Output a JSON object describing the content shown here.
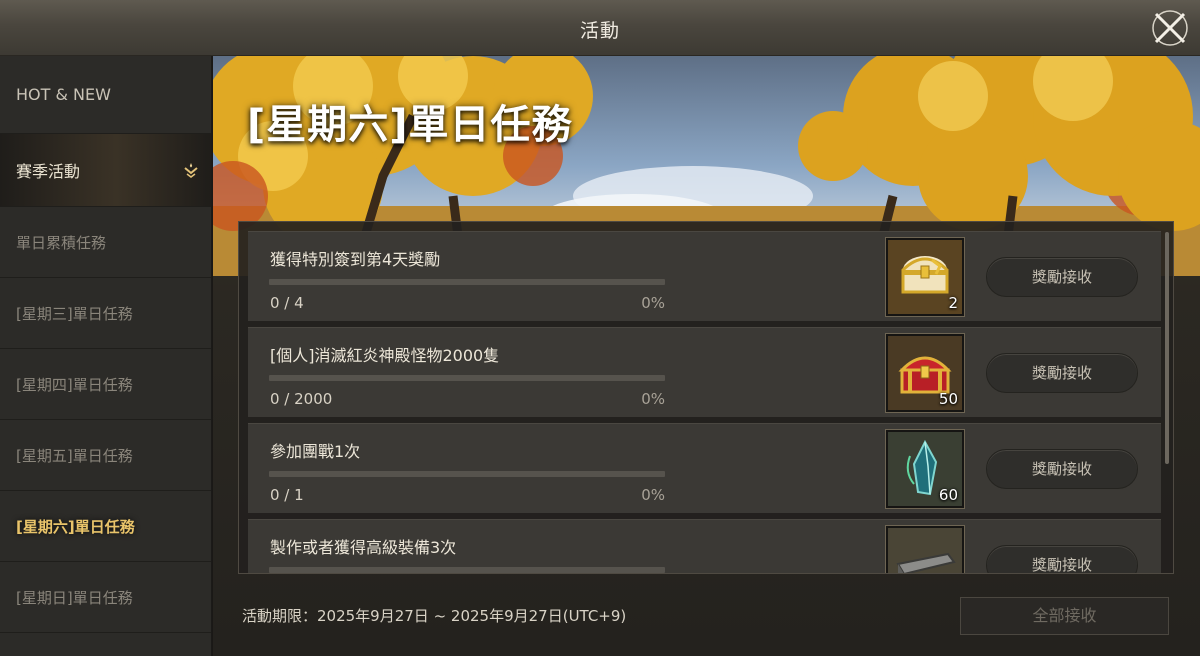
{
  "window": {
    "title": "活動"
  },
  "sidebar": {
    "items": [
      {
        "label": "HOT & NEW"
      },
      {
        "label": "賽季活動"
      },
      {
        "label": "單日累積任務"
      },
      {
        "label": "[星期三]單日任務"
      },
      {
        "label": "[星期四]單日任務"
      },
      {
        "label": "[星期五]單日任務"
      },
      {
        "label": "[星期六]單日任務"
      },
      {
        "label": "[星期日]單日任務"
      }
    ]
  },
  "banner": {
    "title": "[星期六]單日任務"
  },
  "quests": [
    {
      "title": "獲得特別簽到第4天獎勵",
      "progress_text": "0 / 4",
      "percent": "0%",
      "progress": 0,
      "reward_icon": "golden-chest-icon",
      "reward_qty": "2",
      "button": "獎勵接收"
    },
    {
      "title": "[個人]消滅紅炎神殿怪物2000隻",
      "progress_text": "0 / 2000",
      "percent": "0%",
      "progress": 0,
      "reward_icon": "red-chest-icon",
      "reward_qty": "50",
      "button": "獎勵接收"
    },
    {
      "title": "參加團戰1次",
      "progress_text": "0 / 1",
      "percent": "0%",
      "progress": 0,
      "reward_icon": "blue-crystal-icon",
      "reward_qty": "60",
      "button": "獎勵接收"
    },
    {
      "title": "製作或者獲得高級裝備3次",
      "progress_text": "",
      "percent": "",
      "progress": 0,
      "reward_icon": "iron-ingot-icon",
      "reward_qty": "",
      "button": "獎勵接收"
    }
  ],
  "footer": {
    "period": "活動期限：2025年9月27日 ~ 2025年9月27日(UTC+9)",
    "claim_all": "全部接收"
  },
  "colors": {
    "active_tab": "#e9c46a",
    "progress_fill": "#c9a24a"
  }
}
